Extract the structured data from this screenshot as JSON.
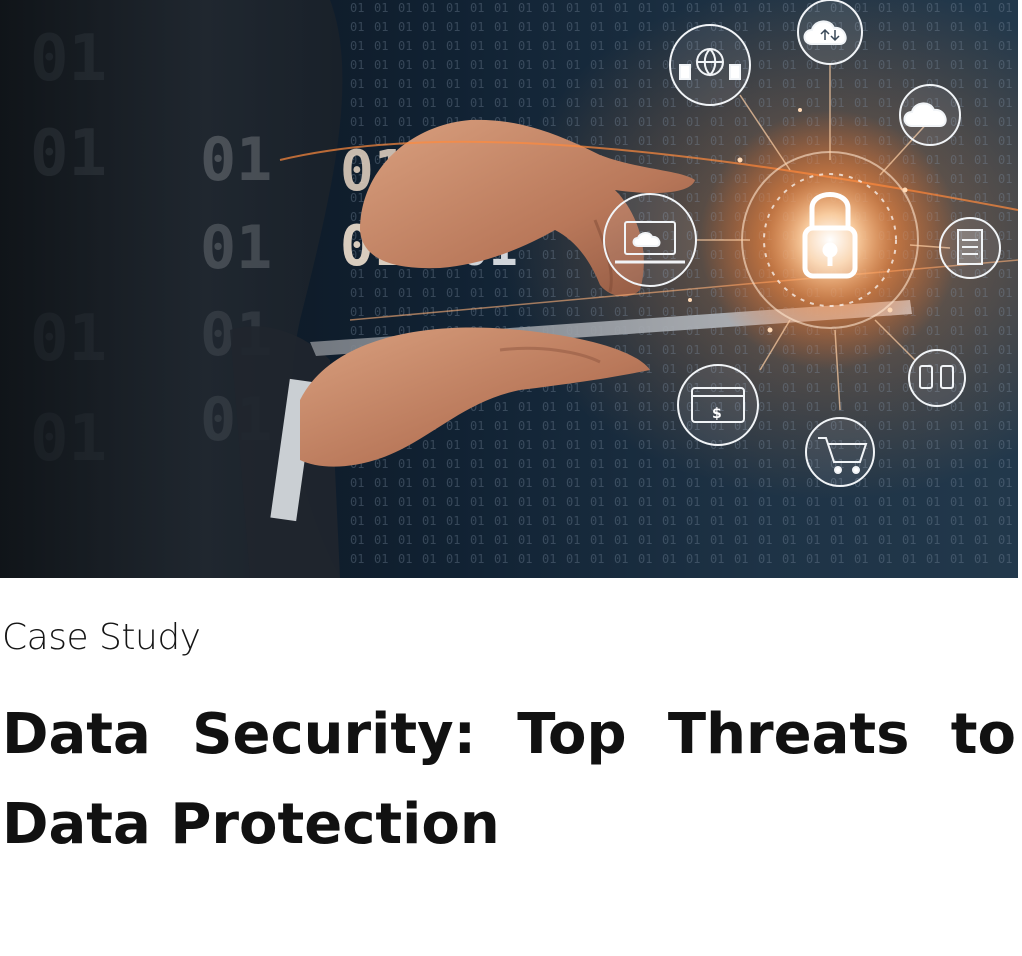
{
  "article": {
    "category": "Case Study",
    "title": "Data Security: Top Threats to Data Protection"
  },
  "hero": {
    "binary_text": "01",
    "icons": [
      "cloud-transfer-icon",
      "people-network-icon",
      "cloud-users-icon",
      "laptop-cloud-icon",
      "padlock-icon",
      "document-icon",
      "payment-card-icon",
      "shopping-cart-icon",
      "mobile-devices-icon"
    ],
    "colors": {
      "background": "#0b1520",
      "glow": "#ff9a4d",
      "hand": "#c98b6b",
      "suit": "#1a1e24"
    }
  }
}
